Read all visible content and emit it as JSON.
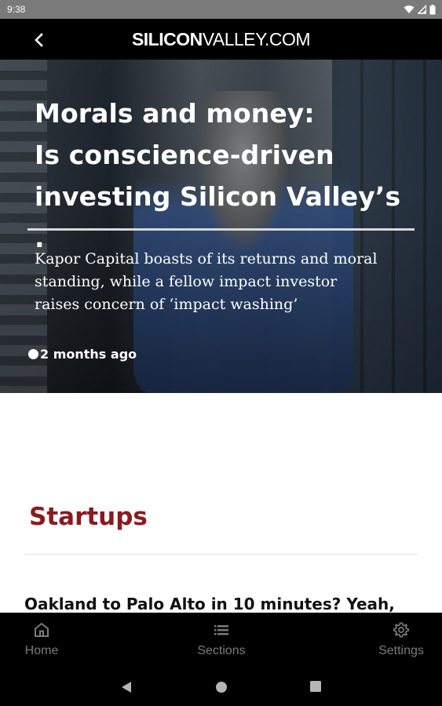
{
  "status_bar": {
    "time": "9:38",
    "icons": [
      "wifi-icon",
      "signal-icon",
      "battery-icon"
    ]
  },
  "header": {
    "brand_bold": "SILICON",
    "brand_light": "VALLEY.COM",
    "back_icon": "chevron-left-icon"
  },
  "hero": {
    "title_lines": [
      "Morals and money:",
      "Is conscience-driven",
      "investing Silicon Valley’s ."
    ],
    "deck_lines": [
      "Kapor Capital boasts of its returns and moral",
      "standing, while a fellow impact investor",
      "raises concern of ‘impact washing’"
    ],
    "time_ago": "2 months ago"
  },
  "section": {
    "title": "Startups",
    "first_story_headline": "Oakland to Palo Alto in 10 minutes? Yeah,"
  },
  "bottom_nav": {
    "items": [
      {
        "label": "Home",
        "icon": "home-icon"
      },
      {
        "label": "Sections",
        "icon": "list-icon"
      },
      {
        "label": "Settings",
        "icon": "gear-icon"
      }
    ]
  },
  "colors": {
    "section_accent": "#8b1a1f",
    "nav_inactive": "#7a7a7a",
    "header_bg": "#000000"
  }
}
